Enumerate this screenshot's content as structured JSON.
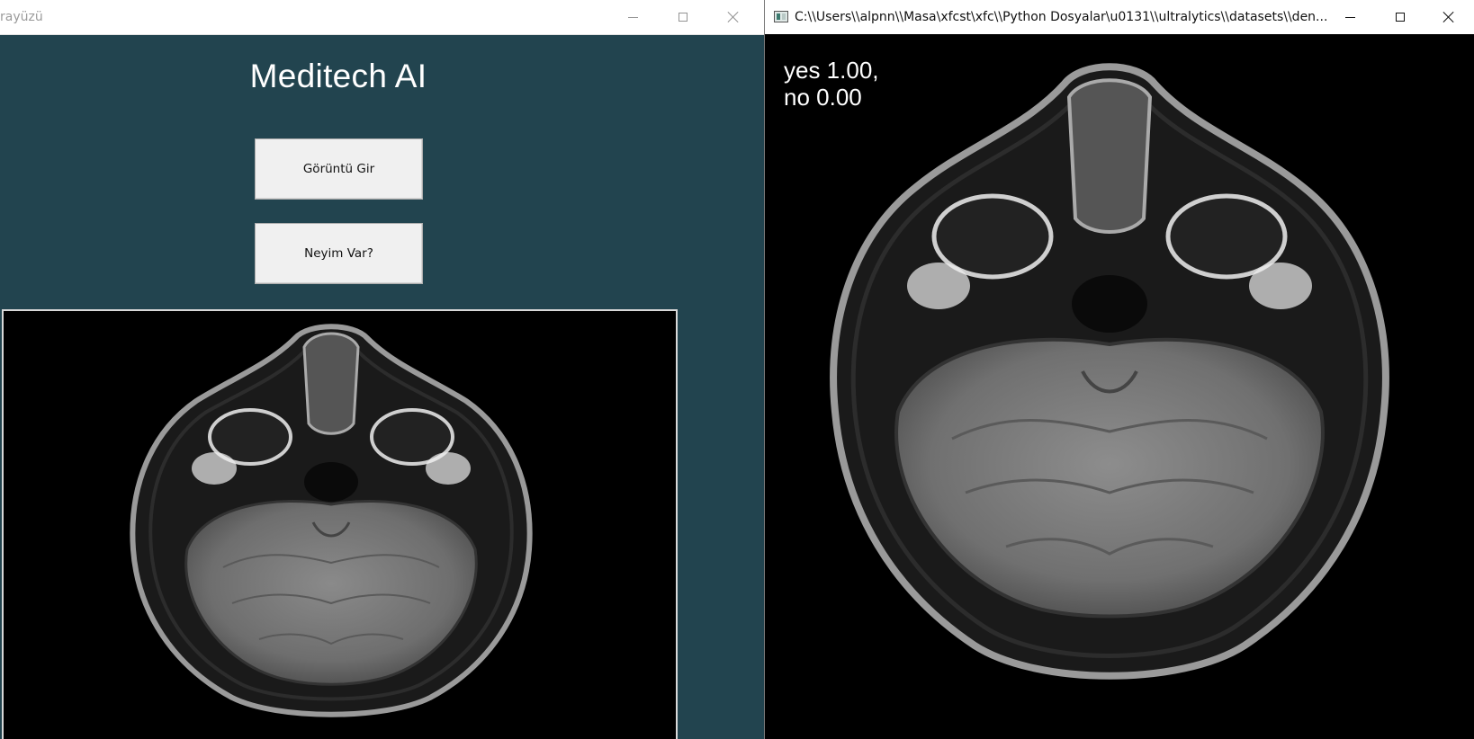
{
  "windows": {
    "main": {
      "title": "rayüzü",
      "app_title": "Meditech AI",
      "buttons": {
        "load_image": "Görüntü Gir",
        "diagnose": "Neyim Var?"
      }
    },
    "result": {
      "title": "C:\\\\Users\\\\alpnn\\\\Masa\\xfcst\\xfc\\\\Python Dosyalar\\u0131\\\\ultralytics\\\\datasets\\\\den...",
      "predictions": [
        {
          "label": "yes",
          "score_text": "1.00,",
          "line": "yes 1.00,"
        },
        {
          "label": "no",
          "score_text": "0.00",
          "line": "no 0.00"
        }
      ]
    }
  },
  "colors": {
    "main_background": "#22444f",
    "image_background": "#000000",
    "button_face": "#f0f0f0",
    "text_light": "#ffffff"
  },
  "icons": {
    "app": "app-icon",
    "minimize": "minimize-icon",
    "maximize": "maximize-icon",
    "close": "close-icon"
  },
  "images": {
    "main_panel": "axial MRI brain scan",
    "result_view": "axial MRI brain scan"
  }
}
